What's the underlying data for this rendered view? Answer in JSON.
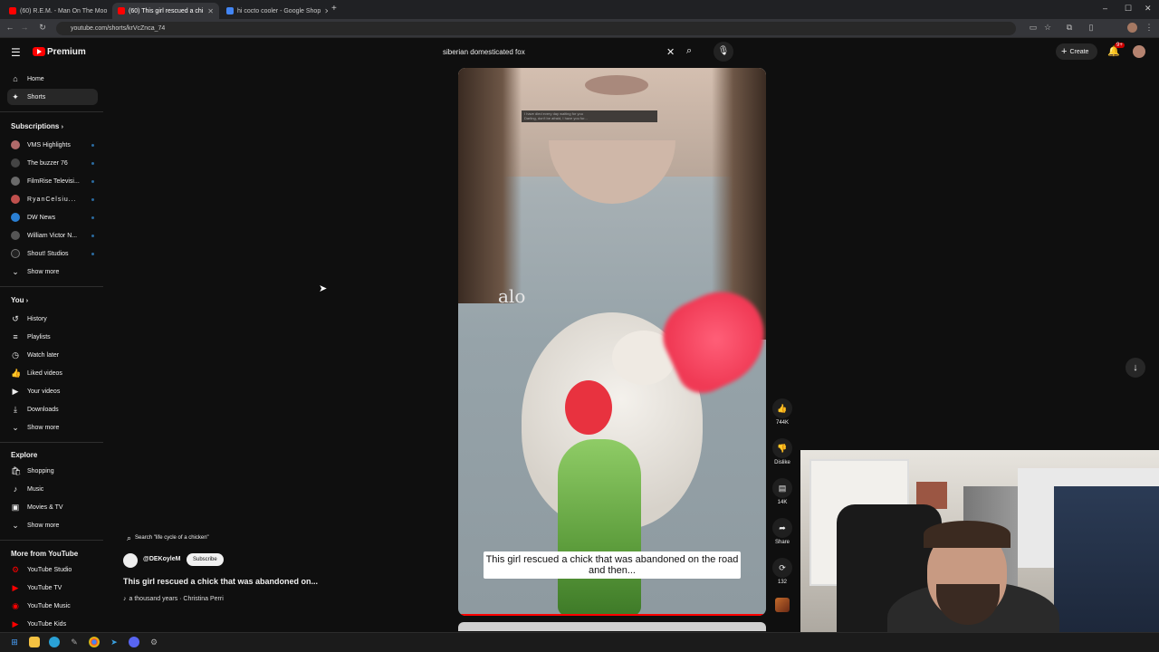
{
  "browser": {
    "tabs": [
      {
        "label": "(60) R.E.M. - Man On The Moo",
        "active": false,
        "color": "#ff0000"
      },
      {
        "label": "(60) This girl rescued a chi",
        "active": true,
        "color": "#ff0000"
      },
      {
        "label": "hi cocto cooler - Google Shop",
        "active": false,
        "color": "#4285f4"
      }
    ],
    "new_tab": "+",
    "url": "youtube.com/shorts/krVcZnca_74"
  },
  "header": {
    "menu_icon": "hamburger-icon",
    "logo_text": "Premium",
    "search_value": "siberian domesticated fox",
    "create_label": "Create",
    "notifications_badge": "9+"
  },
  "sidebar": {
    "main": [
      {
        "label": "Home",
        "icon": "home-icon"
      },
      {
        "label": "Shorts",
        "icon": "shorts-icon",
        "active": true
      }
    ],
    "subscriptions_title": "Subscriptions",
    "subscriptions": [
      {
        "label": "VMS Highlights",
        "color": "#b06a6a"
      },
      {
        "label": "The buzzer 76",
        "color": "#444"
      },
      {
        "label": "FilmRise Televisi...",
        "color": "#6a6a6a"
      },
      {
        "label": "RyanCelsiu...",
        "color": "#c0504d"
      },
      {
        "label": "DW News",
        "color": "#2a7fd4"
      },
      {
        "label": "William Victor N...",
        "color": "#555"
      },
      {
        "label": "Shout! Studios",
        "color": "#222"
      }
    ],
    "show_more_1": "Show more",
    "you_title": "You",
    "you_items": [
      {
        "label": "History",
        "icon": "history-icon"
      },
      {
        "label": "Playlists",
        "icon": "playlists-icon"
      },
      {
        "label": "Watch later",
        "icon": "clock-icon"
      },
      {
        "label": "Liked videos",
        "icon": "thumbs-up-icon"
      },
      {
        "label": "Your videos",
        "icon": "video-icon"
      },
      {
        "label": "Downloads",
        "icon": "download-icon"
      }
    ],
    "show_more_2": "Show more",
    "explore_title": "Explore",
    "explore_items": [
      {
        "label": "Shopping",
        "icon": "shopping-icon"
      },
      {
        "label": "Music",
        "icon": "music-icon"
      },
      {
        "label": "Movies & TV",
        "icon": "movies-icon"
      }
    ],
    "show_more_3": "Show more",
    "more_title": "More from YouTube",
    "more_items": [
      {
        "label": "YouTube Studio"
      },
      {
        "label": "YouTube TV"
      },
      {
        "label": "YouTube Music"
      },
      {
        "label": "YouTube Kids"
      }
    ]
  },
  "short": {
    "search_suggest": "Search \"life cycle of a chicken\"",
    "channel": "@DEKoyleM",
    "subscribe_label": "Subscribe",
    "title": "This girl rescued a chick that was abandoned on...",
    "sound": "a thousand years · Christina Perri",
    "caption": "This girl rescued a chick that was abandoned on the road and then...",
    "top_caption_1": "I have died every day waiting for you",
    "top_caption_2": "Darling, don't be afraid, I have you for...",
    "shirt_text": "alo",
    "actions": [
      {
        "name": "like",
        "label": "744K",
        "icon": "thumbs-up-icon"
      },
      {
        "name": "dislike",
        "label": "Dislike",
        "icon": "thumbs-down-icon"
      },
      {
        "name": "comments",
        "label": "14K",
        "icon": "comment-icon"
      },
      {
        "name": "share",
        "label": "Share",
        "icon": "share-icon"
      },
      {
        "name": "remix",
        "label": "132",
        "icon": "remix-icon"
      }
    ]
  }
}
